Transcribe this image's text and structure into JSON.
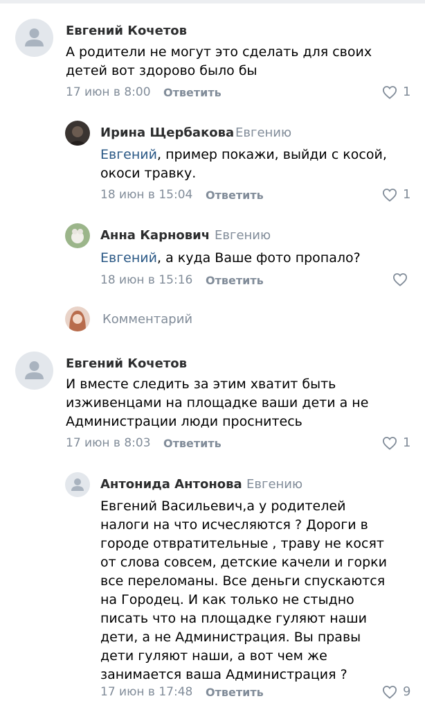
{
  "comments": [
    {
      "author": "Евгений Кочетов",
      "text": "А родители не могут это сделать для своих детей вот здорово было бы",
      "date": "17 июн в 8:00",
      "reply_label": "Ответить",
      "likes": "1"
    },
    {
      "author": "Ирина Щербакова",
      "reply_to": "Евгению",
      "mention": "Евгений",
      "text": ", пример покажи, выйди с косой, окоси травку.",
      "date": "18 июн в 15:04",
      "reply_label": "Ответить",
      "likes": "1"
    },
    {
      "author": "Анна Карнович",
      "reply_to": "Евгению",
      "mention": "Евгений",
      "text": ", а куда Ваше фото пропало?",
      "date": "18 июн в 15:16",
      "reply_label": "Ответить"
    },
    {
      "author": "Евгений Кочетов",
      "text": "И вместе следить за этим хватит быть изживенцами на площадке ваши дети а не Администрации люди проснитесь",
      "date": "17 июн в 8:03",
      "reply_label": "Ответить",
      "likes": "1"
    },
    {
      "author": "Антонида Антонова",
      "reply_to": "Евгению",
      "text": "Евгений Васильевич,а у родителей налоги на что исчесляются ? Дороги в городе отвратительные , траву не косят от слова совсем, детские качели и горки все переломаны. Все деньги спускаются на Городец. И как только не стыдно писать что на площадке гуляют наши дети, а не Администрация. Вы правы дети гуляют наши, а вот чем же занимается ваша Администрация ?",
      "date": "17 июн в 17:48",
      "reply_label": "Ответить",
      "likes": "9"
    }
  ],
  "comment_input": {
    "placeholder": "Комментарий"
  },
  "colors": {
    "link": "#2a5885",
    "secondary": "#818c99",
    "name": "#2c2d2e"
  }
}
